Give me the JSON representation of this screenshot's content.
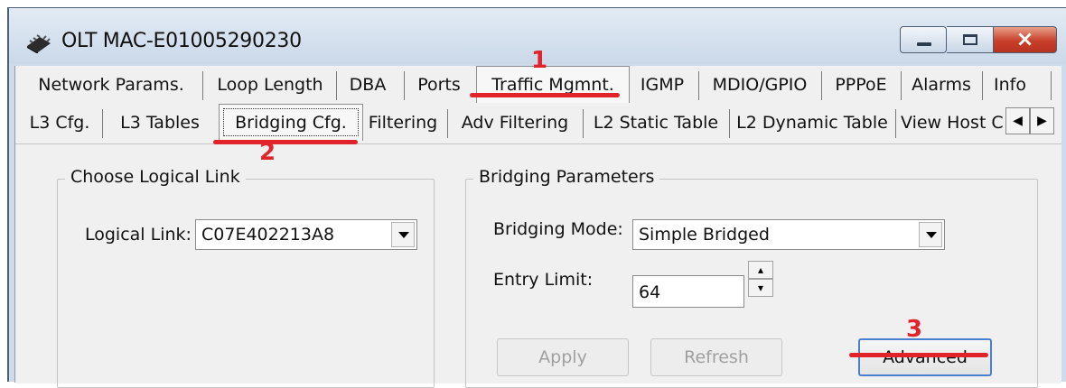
{
  "window": {
    "title": "OLT MAC-E01005290230",
    "close_glyph": "×",
    "app_icon": "chip-icon"
  },
  "tabs_row1": [
    "Network Params.",
    "Loop Length",
    "DBA",
    "Ports",
    "Traffic Mgmnt.",
    "IGMP",
    "MDIO/GPIO",
    "PPPoE",
    "Alarms",
    "Info"
  ],
  "tabs_row2": [
    "L3 Cfg.",
    "L3 Tables",
    "Bridging Cfg.",
    "Filtering",
    "Adv Filtering",
    "L2 Static Table",
    "L2 Dynamic Table",
    "View Host C"
  ],
  "tab_scroll": {
    "left": "◀",
    "right": "▶"
  },
  "logical_link_group": {
    "legend": "Choose Logical Link",
    "label": "Logical Link:",
    "value": "C07E402213A8"
  },
  "bridging_group": {
    "legend": "Bridging Parameters",
    "mode_label": "Bridging Mode:",
    "mode_value": "Simple Bridged",
    "limit_label": "Entry Limit:",
    "limit_value": "64",
    "apply_label": "Apply",
    "refresh_label": "Refresh",
    "advanced_label": "Advanced"
  },
  "spin_glyphs": {
    "up": "▴",
    "down": "▾"
  },
  "annotations": [
    "1",
    "2",
    "3"
  ],
  "colors": {
    "annotation": "#e1242a",
    "default_button_border": "#4a7fd0",
    "close_button": "#c8402a"
  }
}
